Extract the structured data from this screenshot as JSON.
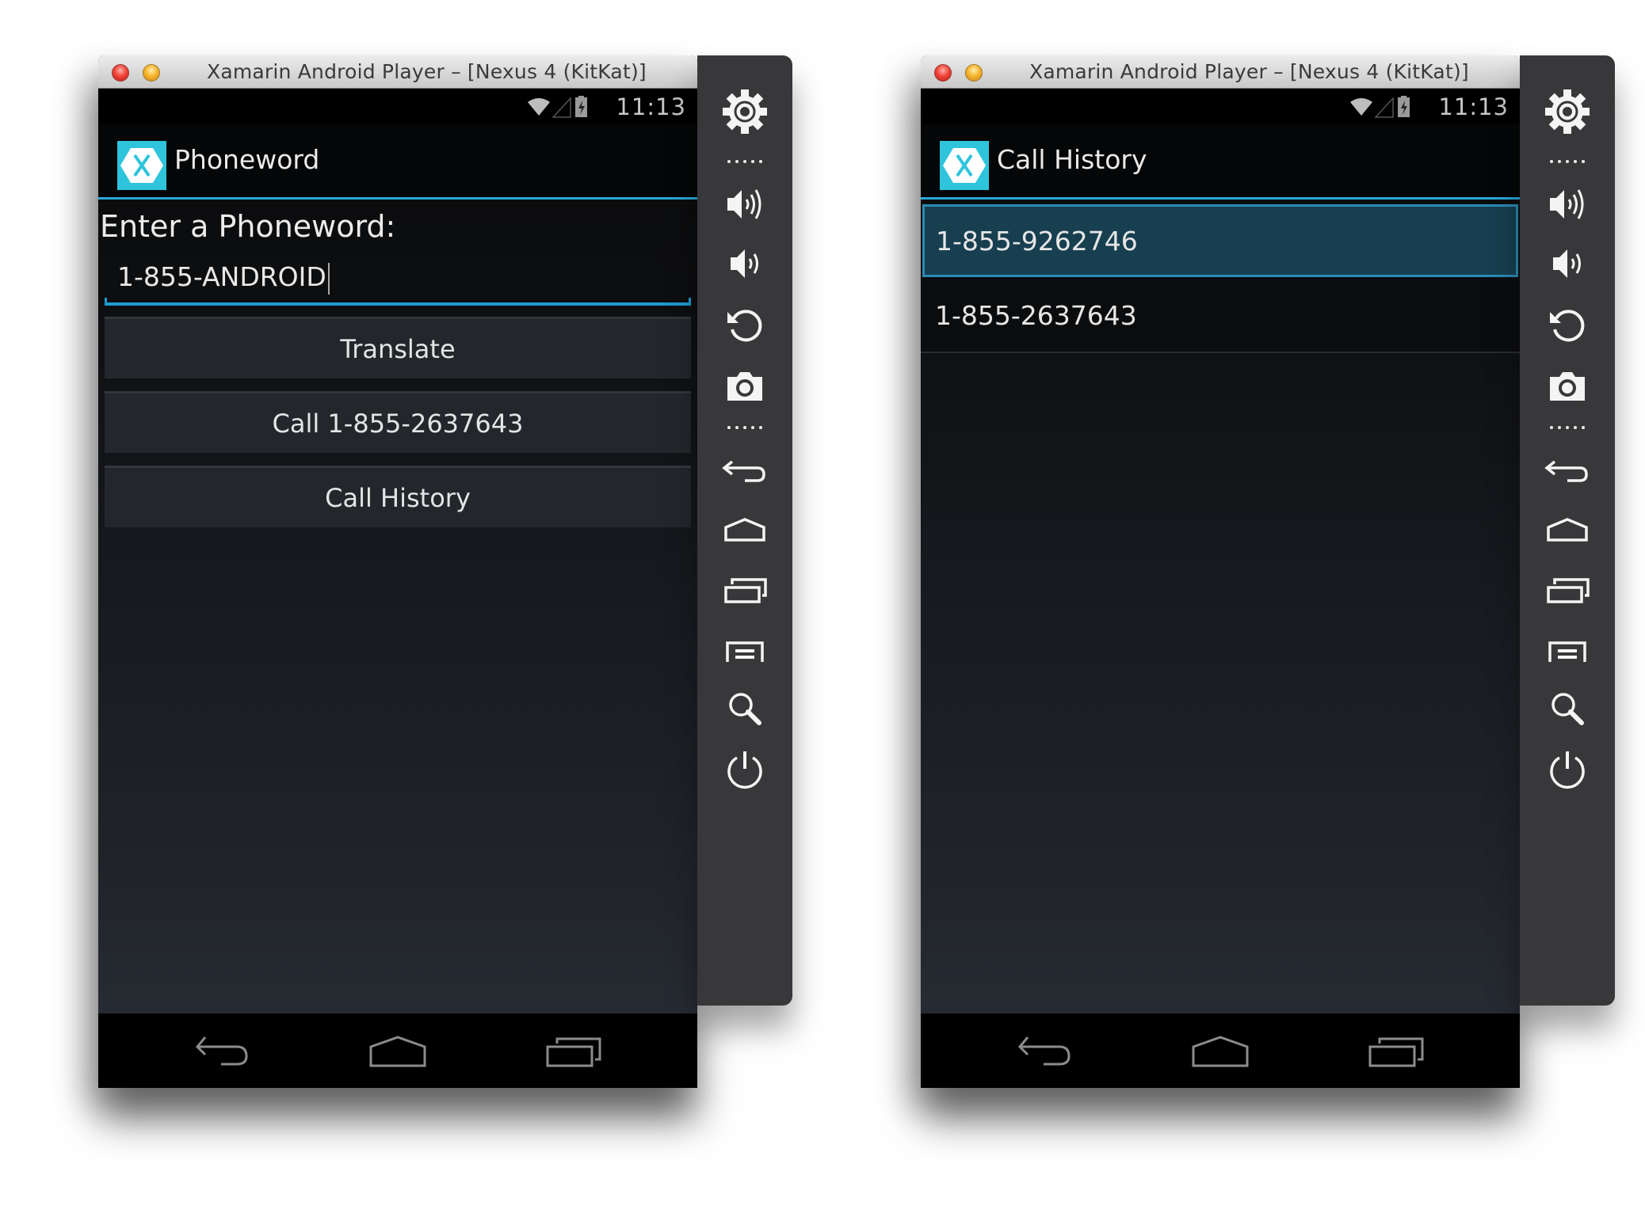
{
  "windows": [
    {
      "title": "Xamarin Android Player – [Nexus 4 (KitKat)]",
      "status_time": "11:13",
      "app_title": "Phoneword",
      "prompt_label": "Enter a Phoneword:",
      "input_value": "1-855-ANDROID",
      "buttons": {
        "translate": "Translate",
        "call": "Call 1-855-2637643",
        "call_history": "Call History"
      }
    },
    {
      "title": "Xamarin Android Player – [Nexus 4 (KitKat)]",
      "status_time": "11:13",
      "app_title": "Call History",
      "list": [
        {
          "number": "1-855-9262746",
          "selected": true
        },
        {
          "number": "1-855-2637643",
          "selected": false
        }
      ]
    }
  ],
  "side_panel": {
    "icons": [
      "gear-icon",
      "separator-dots",
      "volume-up-icon",
      "volume-down-icon",
      "rotate-icon",
      "camera-icon",
      "separator-dots",
      "back-icon",
      "home-icon",
      "recent-apps-icon",
      "menu-icon",
      "search-icon",
      "power-icon"
    ]
  },
  "nav_bar": {
    "icons": [
      "back-icon",
      "home-icon",
      "recent-apps-icon"
    ]
  },
  "colors": {
    "accent_blue": "#2aa8d8",
    "selected_row": "#173f50",
    "xamarin_logo": "#2ec4dc",
    "side_panel_bg": "#38383a"
  }
}
